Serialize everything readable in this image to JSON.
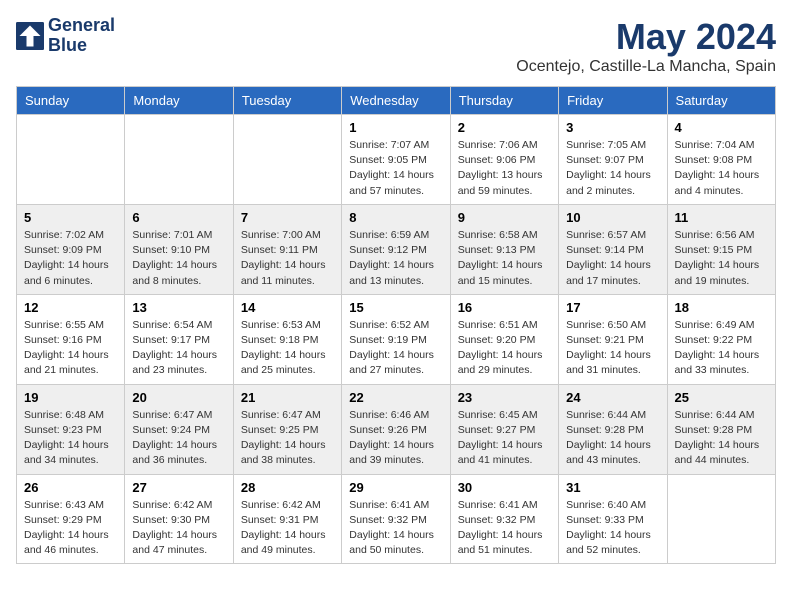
{
  "header": {
    "logo_line1": "General",
    "logo_line2": "Blue",
    "title": "May 2024",
    "subtitle": "Ocentejo, Castille-La Mancha, Spain"
  },
  "weekdays": [
    "Sunday",
    "Monday",
    "Tuesday",
    "Wednesday",
    "Thursday",
    "Friday",
    "Saturday"
  ],
  "weeks": [
    [
      {
        "day": "",
        "sunrise": "",
        "sunset": "",
        "daylight": ""
      },
      {
        "day": "",
        "sunrise": "",
        "sunset": "",
        "daylight": ""
      },
      {
        "day": "",
        "sunrise": "",
        "sunset": "",
        "daylight": ""
      },
      {
        "day": "1",
        "sunrise": "Sunrise: 7:07 AM",
        "sunset": "Sunset: 9:05 PM",
        "daylight": "Daylight: 14 hours and 57 minutes."
      },
      {
        "day": "2",
        "sunrise": "Sunrise: 7:06 AM",
        "sunset": "Sunset: 9:06 PM",
        "daylight": "Daylight: 13 hours and 59 minutes."
      },
      {
        "day": "3",
        "sunrise": "Sunrise: 7:05 AM",
        "sunset": "Sunset: 9:07 PM",
        "daylight": "Daylight: 14 hours and 2 minutes."
      },
      {
        "day": "4",
        "sunrise": "Sunrise: 7:04 AM",
        "sunset": "Sunset: 9:08 PM",
        "daylight": "Daylight: 14 hours and 4 minutes."
      }
    ],
    [
      {
        "day": "5",
        "sunrise": "Sunrise: 7:02 AM",
        "sunset": "Sunset: 9:09 PM",
        "daylight": "Daylight: 14 hours and 6 minutes."
      },
      {
        "day": "6",
        "sunrise": "Sunrise: 7:01 AM",
        "sunset": "Sunset: 9:10 PM",
        "daylight": "Daylight: 14 hours and 8 minutes."
      },
      {
        "day": "7",
        "sunrise": "Sunrise: 7:00 AM",
        "sunset": "Sunset: 9:11 PM",
        "daylight": "Daylight: 14 hours and 11 minutes."
      },
      {
        "day": "8",
        "sunrise": "Sunrise: 6:59 AM",
        "sunset": "Sunset: 9:12 PM",
        "daylight": "Daylight: 14 hours and 13 minutes."
      },
      {
        "day": "9",
        "sunrise": "Sunrise: 6:58 AM",
        "sunset": "Sunset: 9:13 PM",
        "daylight": "Daylight: 14 hours and 15 minutes."
      },
      {
        "day": "10",
        "sunrise": "Sunrise: 6:57 AM",
        "sunset": "Sunset: 9:14 PM",
        "daylight": "Daylight: 14 hours and 17 minutes."
      },
      {
        "day": "11",
        "sunrise": "Sunrise: 6:56 AM",
        "sunset": "Sunset: 9:15 PM",
        "daylight": "Daylight: 14 hours and 19 minutes."
      }
    ],
    [
      {
        "day": "12",
        "sunrise": "Sunrise: 6:55 AM",
        "sunset": "Sunset: 9:16 PM",
        "daylight": "Daylight: 14 hours and 21 minutes."
      },
      {
        "day": "13",
        "sunrise": "Sunrise: 6:54 AM",
        "sunset": "Sunset: 9:17 PM",
        "daylight": "Daylight: 14 hours and 23 minutes."
      },
      {
        "day": "14",
        "sunrise": "Sunrise: 6:53 AM",
        "sunset": "Sunset: 9:18 PM",
        "daylight": "Daylight: 14 hours and 25 minutes."
      },
      {
        "day": "15",
        "sunrise": "Sunrise: 6:52 AM",
        "sunset": "Sunset: 9:19 PM",
        "daylight": "Daylight: 14 hours and 27 minutes."
      },
      {
        "day": "16",
        "sunrise": "Sunrise: 6:51 AM",
        "sunset": "Sunset: 9:20 PM",
        "daylight": "Daylight: 14 hours and 29 minutes."
      },
      {
        "day": "17",
        "sunrise": "Sunrise: 6:50 AM",
        "sunset": "Sunset: 9:21 PM",
        "daylight": "Daylight: 14 hours and 31 minutes."
      },
      {
        "day": "18",
        "sunrise": "Sunrise: 6:49 AM",
        "sunset": "Sunset: 9:22 PM",
        "daylight": "Daylight: 14 hours and 33 minutes."
      }
    ],
    [
      {
        "day": "19",
        "sunrise": "Sunrise: 6:48 AM",
        "sunset": "Sunset: 9:23 PM",
        "daylight": "Daylight: 14 hours and 34 minutes."
      },
      {
        "day": "20",
        "sunrise": "Sunrise: 6:47 AM",
        "sunset": "Sunset: 9:24 PM",
        "daylight": "Daylight: 14 hours and 36 minutes."
      },
      {
        "day": "21",
        "sunrise": "Sunrise: 6:47 AM",
        "sunset": "Sunset: 9:25 PM",
        "daylight": "Daylight: 14 hours and 38 minutes."
      },
      {
        "day": "22",
        "sunrise": "Sunrise: 6:46 AM",
        "sunset": "Sunset: 9:26 PM",
        "daylight": "Daylight: 14 hours and 39 minutes."
      },
      {
        "day": "23",
        "sunrise": "Sunrise: 6:45 AM",
        "sunset": "Sunset: 9:27 PM",
        "daylight": "Daylight: 14 hours and 41 minutes."
      },
      {
        "day": "24",
        "sunrise": "Sunrise: 6:44 AM",
        "sunset": "Sunset: 9:28 PM",
        "daylight": "Daylight: 14 hours and 43 minutes."
      },
      {
        "day": "25",
        "sunrise": "Sunrise: 6:44 AM",
        "sunset": "Sunset: 9:28 PM",
        "daylight": "Daylight: 14 hours and 44 minutes."
      }
    ],
    [
      {
        "day": "26",
        "sunrise": "Sunrise: 6:43 AM",
        "sunset": "Sunset: 9:29 PM",
        "daylight": "Daylight: 14 hours and 46 minutes."
      },
      {
        "day": "27",
        "sunrise": "Sunrise: 6:42 AM",
        "sunset": "Sunset: 9:30 PM",
        "daylight": "Daylight: 14 hours and 47 minutes."
      },
      {
        "day": "28",
        "sunrise": "Sunrise: 6:42 AM",
        "sunset": "Sunset: 9:31 PM",
        "daylight": "Daylight: 14 hours and 49 minutes."
      },
      {
        "day": "29",
        "sunrise": "Sunrise: 6:41 AM",
        "sunset": "Sunset: 9:32 PM",
        "daylight": "Daylight: 14 hours and 50 minutes."
      },
      {
        "day": "30",
        "sunrise": "Sunrise: 6:41 AM",
        "sunset": "Sunset: 9:32 PM",
        "daylight": "Daylight: 14 hours and 51 minutes."
      },
      {
        "day": "31",
        "sunrise": "Sunrise: 6:40 AM",
        "sunset": "Sunset: 9:33 PM",
        "daylight": "Daylight: 14 hours and 52 minutes."
      },
      {
        "day": "",
        "sunrise": "",
        "sunset": "",
        "daylight": ""
      }
    ]
  ]
}
